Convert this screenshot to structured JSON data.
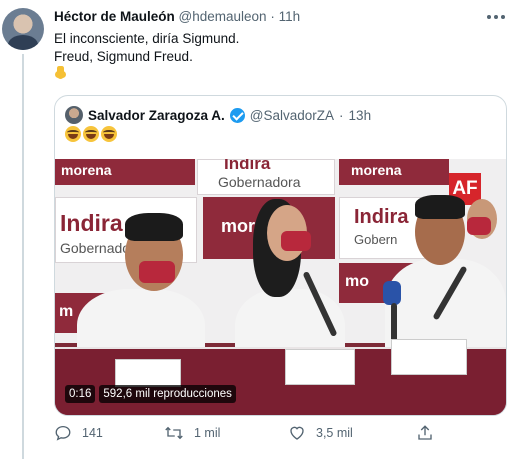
{
  "tweet": {
    "author_name": "Héctor de Mauleón",
    "author_handle": "@hdemauleon",
    "separator": "·",
    "time": "11h",
    "line1": "El inconsciente, diría Sigmund.",
    "line2": "Freud, Sigmund Freud."
  },
  "quote": {
    "author_name": "Salvador Zaragoza A.",
    "author_handle": "@SalvadorZA",
    "separator": "·",
    "time": "13h",
    "verified": true,
    "emojis": [
      "laugh-cry-emoji",
      "laugh-cry-emoji",
      "laugh-cry-emoji"
    ]
  },
  "video": {
    "banner": {
      "morena_top_left": "morena",
      "indira_top": "Indira",
      "gobernadora_top": "Gobernadora",
      "morena_top_right": "morena",
      "indira_left": "Indira",
      "gobernadora_left": "Gobernadora",
      "mor_center": "mor",
      "indira_right": "Indira",
      "gobernadora_right": "Gobern",
      "mo_right": "mo",
      "mo_left": "m",
      "network": "AF"
    },
    "duration": "0:16",
    "views": "592,6 mil reproducciones"
  },
  "actions": {
    "replies": "141",
    "retweets": "1 mil",
    "likes": "3,5 mil"
  },
  "colors": {
    "accent": "#1d9bf0",
    "text": "#0f1419",
    "muted": "#536471",
    "border": "#cfd9de"
  }
}
